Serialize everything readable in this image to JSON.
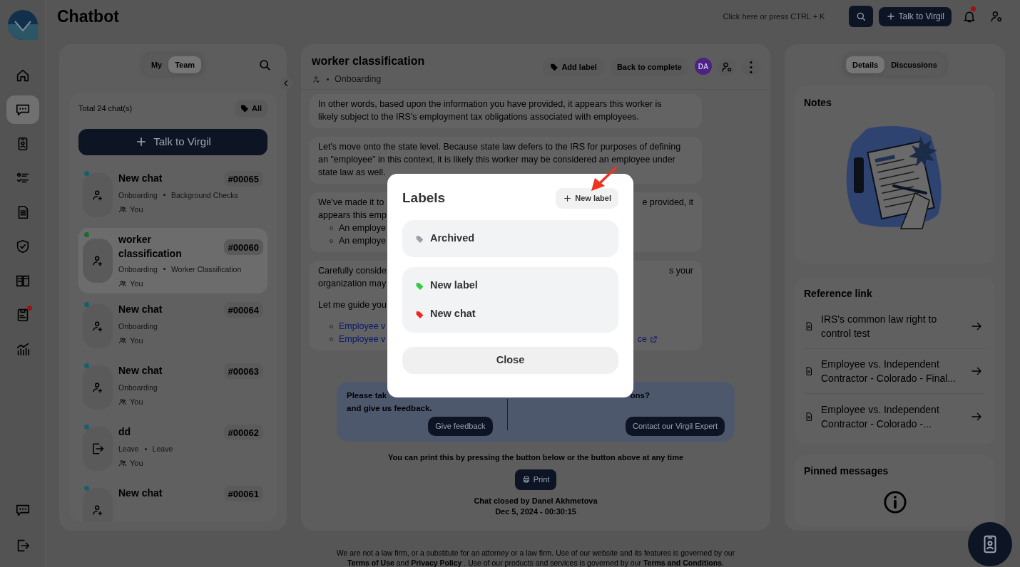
{
  "app": {
    "title": "Chatbot"
  },
  "rail": {
    "items": [
      {
        "kind": "home",
        "selected": false,
        "alert": false
      },
      {
        "kind": "chat",
        "selected": true,
        "alert": false
      },
      {
        "kind": "badge",
        "selected": false,
        "alert": false
      },
      {
        "kind": "tasks",
        "selected": false,
        "alert": false
      },
      {
        "kind": "document",
        "selected": false,
        "alert": false
      },
      {
        "kind": "shield",
        "selected": false,
        "alert": false
      },
      {
        "kind": "book",
        "selected": false,
        "alert": false
      },
      {
        "kind": "clipboard",
        "selected": false,
        "alert": true
      },
      {
        "kind": "chart",
        "selected": false,
        "alert": false
      }
    ],
    "bottom_items": [
      {
        "kind": "chat",
        "selected": false,
        "alert": false
      },
      {
        "kind": "logout",
        "selected": false,
        "alert": false
      }
    ]
  },
  "top_bar": {
    "search_placeholder": "Click here or press CTRL + K",
    "cta": "Talk to Virgil",
    "notification_alert": true
  },
  "chat_list": {
    "tabs": [
      {
        "label": "My",
        "selected": false
      },
      {
        "label": "Team",
        "selected": true
      }
    ],
    "total": "Total 24 chat(s)",
    "filter": "All",
    "new_button": "Talk to Virgil",
    "chats": [
      {
        "title": "New chat",
        "id": "#00065",
        "kind": "join",
        "color": "#17606b",
        "selected": false,
        "tags": [
          "Onboarding",
          "Background Checks"
        ],
        "owner": "You"
      },
      {
        "title": "worker classification",
        "id": "#00060",
        "kind": "join",
        "color": "#1e6a2c",
        "selected": true,
        "tags": [
          "Onboarding",
          "Worker Classification"
        ],
        "owner": "You"
      },
      {
        "title": "New chat",
        "id": "#00064",
        "kind": "join",
        "color": "#17606b",
        "selected": false,
        "tags": [
          "Onboarding"
        ],
        "owner": "You"
      },
      {
        "title": "New chat",
        "id": "#00063",
        "kind": "join",
        "color": "#17606b",
        "selected": false,
        "tags": [
          "Onboarding"
        ],
        "owner": "You"
      },
      {
        "title": "dd",
        "id": "#00062",
        "kind": "leave",
        "color": "#17606b",
        "selected": false,
        "tags": [
          "Leave",
          "Leave"
        ],
        "owner": "You"
      },
      {
        "title": "New chat",
        "id": "#00061",
        "kind": "join",
        "color": "#17606b",
        "selected": false
      }
    ]
  },
  "conversation": {
    "title": "worker classification",
    "category": "Onboarding",
    "actions": [
      "Add label",
      "Back to complete"
    ],
    "avatar": "DA",
    "messages": [
      {
        "blocks": [
          {
            "kind": "text",
            "left": "In other words, based upon the information you have provided, it appears this worker is"
          },
          {
            "kind": "text",
            "left": "likely subject to the IRS's employment tax obligations associated with employees."
          }
        ]
      },
      {
        "blocks": [
          {
            "kind": "text",
            "left": "Let's move onto the state level. Because state law defers to the IRS for purposes of defining"
          },
          {
            "kind": "text",
            "left": "an \"employee\" in this context, it is likely this worker may be considered an employee under"
          },
          {
            "kind": "text",
            "left": "state law as well."
          }
        ]
      },
      {
        "blocks": [
          {
            "kind": "text",
            "left": "We've made it to",
            "right": "e provided, it"
          },
          {
            "kind": "text",
            "left": "appears this emp"
          },
          {
            "kind": "bullet",
            "left": "An employe"
          },
          {
            "kind": "bullet",
            "left": "An employe"
          }
        ]
      },
      {
        "blocks": [
          {
            "kind": "text",
            "left": "Carefully conside",
            "right": "s your"
          },
          {
            "kind": "text",
            "left": "organization may"
          },
          {
            "kind": "gap"
          },
          {
            "kind": "text",
            "left": "Let me guide you"
          },
          {
            "kind": "gap"
          },
          {
            "kind": "link",
            "left": "Employee v"
          },
          {
            "kind": "link",
            "left": "Employee v",
            "right": "ce"
          }
        ]
      }
    ],
    "feedback": {
      "left_lines": [
        "Please tak",
        "and give us feedback."
      ],
      "right_lines": [
        "ons?"
      ],
      "buttons": [
        "Give feedback",
        "Contact our Virgil Expert"
      ]
    },
    "print_note": "You can print this by pressing the button below or the button above at any time",
    "print_button": "Print",
    "closed_by": "Chat closed by Danel Akhmetova",
    "closed_at": "Dec 5, 2024 - 00:30:15"
  },
  "details": {
    "tabs": [
      {
        "label": "Details",
        "selected": true
      },
      {
        "label": "Discussions",
        "selected": false
      }
    ],
    "notes_title": "Notes",
    "reference_title": "Reference link",
    "references": [
      "IRS's common law right to control test",
      "Employee vs. Independent Contractor - Colorado - Final...",
      "Employee vs. Independent Contractor - Colorado -..."
    ],
    "pinned_title": "Pinned messages"
  },
  "footer": [
    "We are not a law firm, or a substitute for an attorney or a law firm. Use of our website and its features is governed by our",
    "**Terms of Use** and **Privacy Policy** . Use of our products and services is governed by our **Terms and Conditions**."
  ],
  "labels_dialog": {
    "title": "Labels",
    "new_button": "New label",
    "groups": [
      {
        "labels": [
          {
            "name": "Archived",
            "color": "#9ba1a9"
          }
        ]
      },
      {
        "labels": [
          {
            "name": "New label",
            "color": "#2ecc40"
          },
          {
            "name": "New chat",
            "color": "#f02424"
          }
        ]
      }
    ],
    "close": "Close"
  }
}
